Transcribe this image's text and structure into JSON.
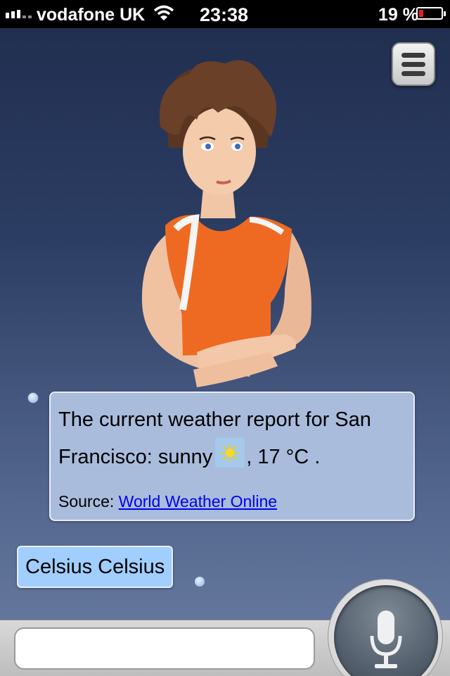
{
  "status_bar": {
    "carrier": "vodafone UK",
    "time": "23:38",
    "battery_percent": "19 %",
    "battery_level": 0.19
  },
  "bot_message": {
    "line1": "The current weather report for San",
    "line2_prefix": "Francisco: sunny",
    "line2_suffix": ", 17 °C .",
    "source_label": "Source:",
    "source_link": "World Weather Online"
  },
  "user_message": {
    "text": "Celsius Celsius"
  },
  "input": {
    "value": "",
    "placeholder": ""
  },
  "icons": {
    "weather": "sun-icon",
    "menu": "menu-icon",
    "mic": "microphone-icon"
  },
  "colors": {
    "bot_bubble": "#a9bcdc",
    "user_bubble": "#a0ceff",
    "link": "#0000ee",
    "battery_low": "#e02020"
  }
}
